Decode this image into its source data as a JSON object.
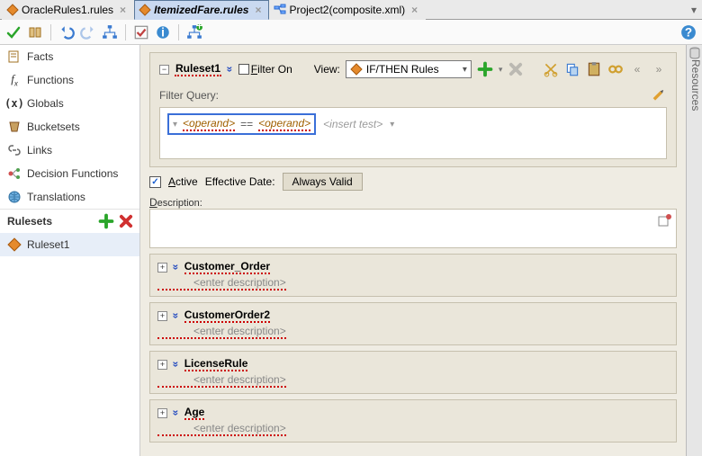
{
  "tabs": [
    {
      "label": "OracleRules1.rules",
      "active": false,
      "icon": "rule"
    },
    {
      "label": "ItemizedFare.rules",
      "active": true,
      "icon": "rule",
      "dirty": true
    },
    {
      "label": "Project2(composite.xml)",
      "active": false,
      "icon": "composite"
    }
  ],
  "sidebar": {
    "items": [
      {
        "label": "Facts"
      },
      {
        "label": "Functions"
      },
      {
        "label": "Globals"
      },
      {
        "label": "Bucketsets"
      },
      {
        "label": "Links"
      },
      {
        "label": "Decision Functions"
      },
      {
        "label": "Translations"
      }
    ],
    "rulesets_header": "Rulesets",
    "ruleset_items": [
      {
        "label": "Ruleset1",
        "selected": true
      }
    ]
  },
  "ruleset_panel": {
    "name": "Ruleset1",
    "filter_on_label": "Filter On",
    "view_label": "View:",
    "view_value": "IF/THEN Rules",
    "filter_query_label": "Filter Query:",
    "operand_left": "<operand>",
    "operator": "==",
    "operand_right": "<operand>",
    "insert_test": "<insert test>"
  },
  "active_row": {
    "active_label": "Active",
    "active_checked": true,
    "effective_date_label": "Effective Date:",
    "effective_date_value": "Always Valid"
  },
  "description": {
    "label": "Description:"
  },
  "rules": [
    {
      "name": "Customer_Order",
      "desc": "<enter description>"
    },
    {
      "name": "CustomerOrder2",
      "desc": "<enter description>"
    },
    {
      "name": "LicenseRule",
      "desc": "<enter description>"
    },
    {
      "name": "Age",
      "desc": "<enter description>"
    }
  ],
  "right_rail": "Resources"
}
